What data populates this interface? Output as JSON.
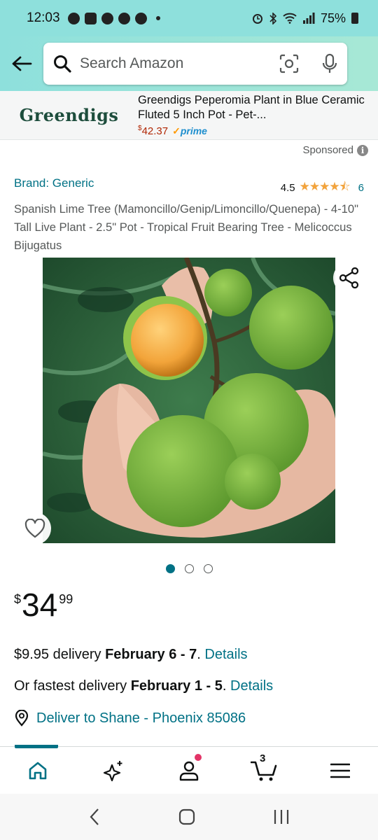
{
  "status_bar": {
    "time": "12:03",
    "battery": "75%"
  },
  "search": {
    "placeholder": "Search Amazon"
  },
  "ad": {
    "logo": "Greendigs",
    "title": "Greendigs Peperomia Plant in Blue Ceramic Fluted 5 Inch Pot - Pet-...",
    "price_symbol": "$",
    "price": "42.37",
    "prime": "prime"
  },
  "sponsored": "Sponsored",
  "product": {
    "brand": "Brand: Generic",
    "rating": "4.5",
    "rating_count": "6",
    "title": "Spanish Lime Tree (Mamoncillo/Genip/Limoncillo/Quenepa) - 4-10\" Tall Live Plant - 2.5\" Pot - Tropical Fruit Bearing Tree - Melicoccus Bijugatus",
    "image_count": 3,
    "active_image": 1,
    "price": {
      "symbol": "$",
      "whole": "34",
      "fraction": "99"
    }
  },
  "delivery": {
    "cost": "$9.95 delivery ",
    "dates": "February 6 - 7",
    "period": ". ",
    "details": "Details",
    "fastest_prefix": "Or fastest delivery ",
    "fastest_dates": "February 1 - 5",
    "fastest_period": ". ",
    "fastest_details": "Details",
    "deliver_to": "Deliver to Shane - Phoenix 85086"
  },
  "nav": {
    "cart_count": "3"
  },
  "colors": {
    "accent": "#007185",
    "price_red": "#b12704",
    "header": "#8ee0dc"
  }
}
